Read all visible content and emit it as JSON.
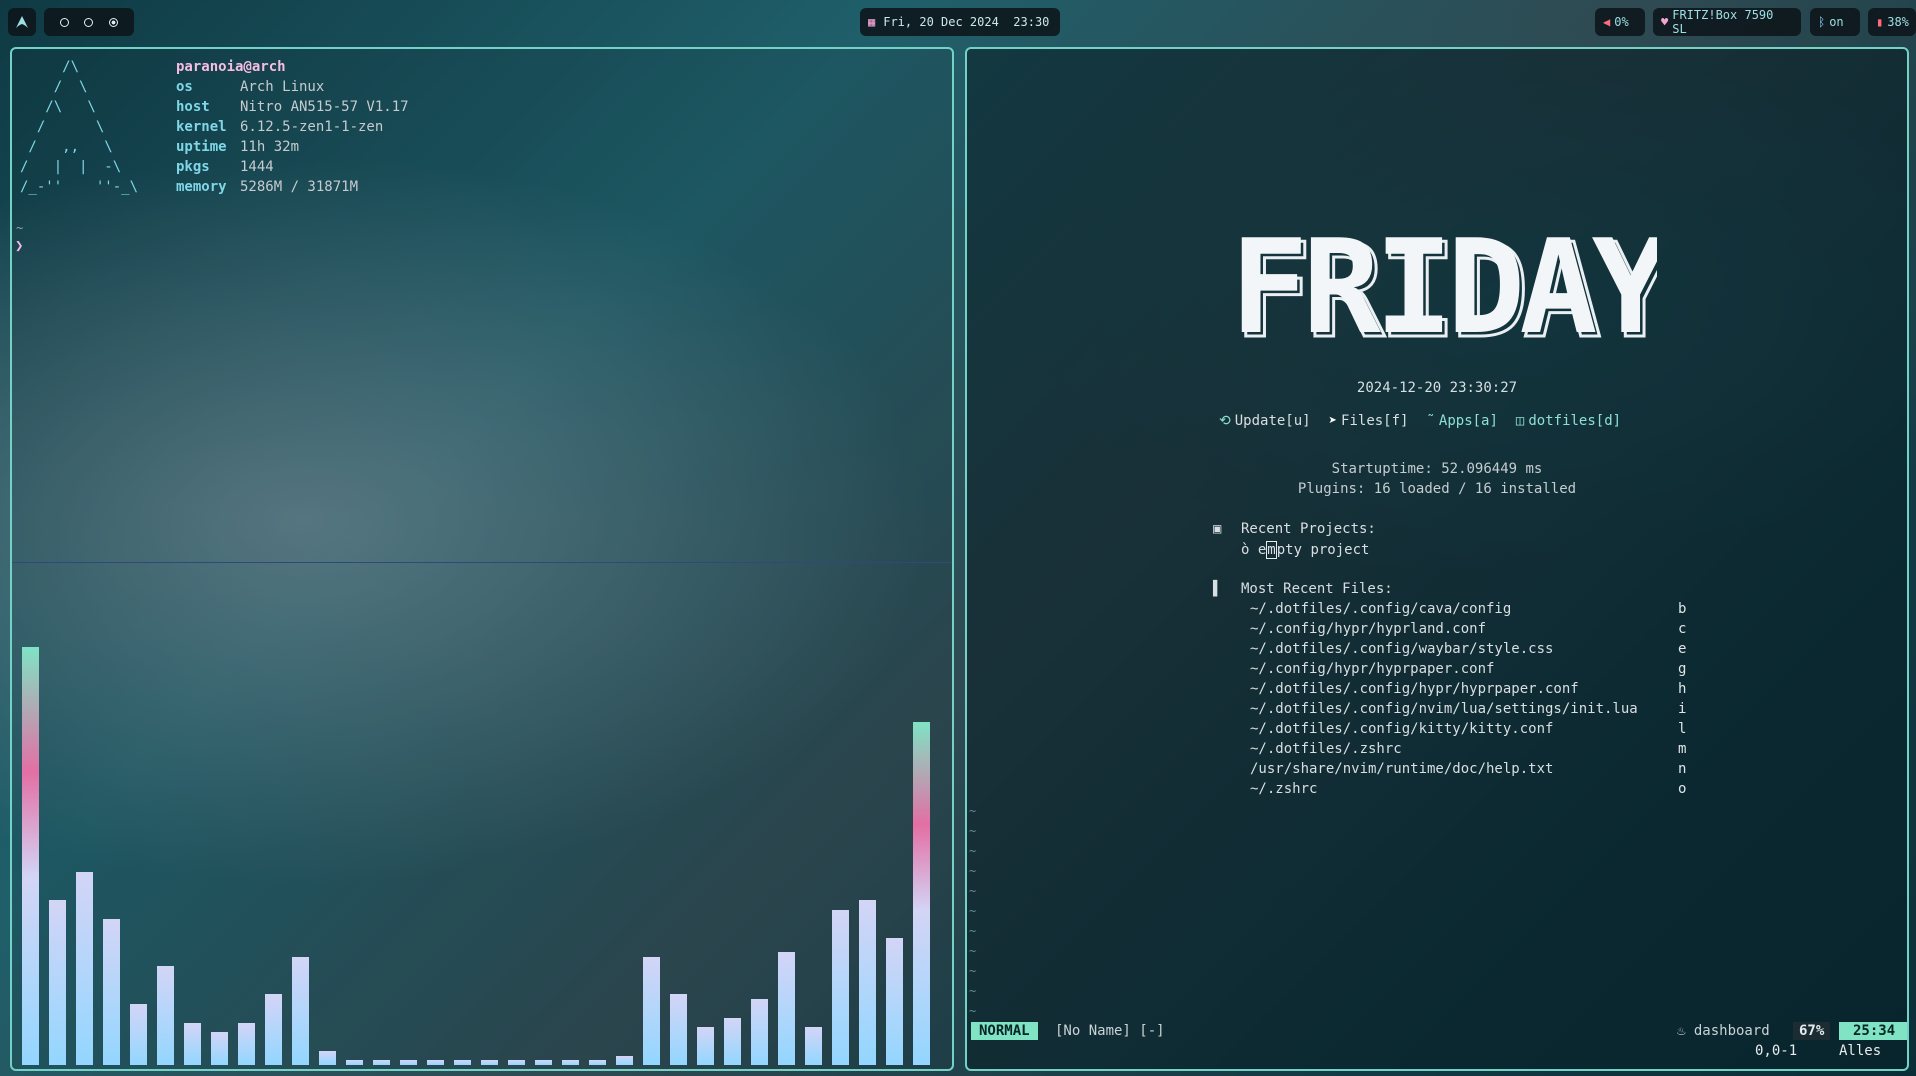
{
  "topbar": {
    "launcher_icon": "arch-logo-icon",
    "workspaces": [
      {
        "icon": "circle-icon",
        "active": false
      },
      {
        "icon": "circle-icon",
        "active": false
      },
      {
        "icon": "circle-dot-icon",
        "active": true
      }
    ],
    "calendar_icon": "calendar-icon",
    "clock": "Fri, 20 Dec 2024  23:30",
    "volume": "0%",
    "wifi": "FRITZ!Box 7590 SL",
    "bluetooth": "on",
    "battery": "38%"
  },
  "fetch": {
    "ascii_logo": "     /\\\n    /  \\\n   /\\   \\\n  /      \\\n /   ,,   \\\n/   |  |  -\\\n/_-''    ''-_\\",
    "user": "paranoia@arch",
    "rows": [
      {
        "key": "os",
        "value": "Arch Linux"
      },
      {
        "key": "host",
        "value": "Nitro AN515-57 V1.17"
      },
      {
        "key": "kernel",
        "value": "6.12.5-zen1-1-zen"
      },
      {
        "key": "uptime",
        "value": "11h 32m"
      },
      {
        "key": "pkgs",
        "value": "1444"
      },
      {
        "key": "memory",
        "value": "5286M / 31871M"
      }
    ],
    "tilde": "~",
    "prompt": "❯"
  },
  "cava": {
    "levels": [
      0.89,
      0.35,
      0.41,
      0.31,
      0.13,
      0.21,
      0.09,
      0.07,
      0.09,
      0.15,
      0.23,
      0.03,
      0.01,
      0.01,
      0.01,
      0.01,
      0.01,
      0.01,
      0.01,
      0.01,
      0.01,
      0.01,
      0.02,
      0.23,
      0.15,
      0.08,
      0.1,
      0.14,
      0.24,
      0.08,
      0.33,
      0.35,
      0.27,
      0.73
    ],
    "colors": {
      "low": "#93d6ff",
      "high": "#d3d5f6",
      "peak": "#e36fa4",
      "accent": "#7fe3c4"
    }
  },
  "nvim": {
    "header_word": "FRIDAY",
    "datetime": "2024-12-20 23:30:27",
    "buttons": [
      {
        "icon": "refresh-icon",
        "label": "Update[u]"
      },
      {
        "icon": "send-icon",
        "label": "Files[f]"
      },
      {
        "icon": "tilde-icon",
        "label": "Apps[a]"
      },
      {
        "icon": "package-icon",
        "label": "dotfiles[d]"
      }
    ],
    "startuptime": "Startuptime: 52.096449 ms",
    "plugins": "Plugins: 16 loaded / 16 installed",
    "recent_projects_icon": "folder-icon",
    "recent_projects_title": "Recent Projects:",
    "empty_project_pre": "ò e",
    "empty_project_cursor": "m",
    "empty_project_post": "pty project",
    "recent_files_icon": "file-icon",
    "recent_files_title": "Most Recent Files:",
    "files": [
      {
        "path": "~/.dotfiles/.config/cava/config",
        "key": "b"
      },
      {
        "path": "~/.config/hypr/hyprland.conf",
        "key": "c"
      },
      {
        "path": "~/.dotfiles/.config/waybar/style.css",
        "key": "e"
      },
      {
        "path": "~/.config/hypr/hyprpaper.conf",
        "key": "g"
      },
      {
        "path": "~/.dotfiles/.config/hypr/hyprpaper.conf",
        "key": "h"
      },
      {
        "path": "~/.dotfiles/.config/nvim/lua/settings/init.lua",
        "key": "i"
      },
      {
        "path": "~/.dotfiles/.config/kitty/kitty.conf",
        "key": "l"
      },
      {
        "path": "~/.dotfiles/.zshrc",
        "key": "m"
      },
      {
        "path": "/usr/share/nvim/runtime/doc/help.txt",
        "key": "n"
      },
      {
        "path": "~/.zshrc",
        "key": "o"
      }
    ],
    "tildes": "~\n~\n~\n~\n~\n~\n~\n~\n~\n~\n~",
    "status": {
      "mode": "NORMAL",
      "buffer": "[No Name] [-]",
      "filetype_icon": "flame-icon",
      "filetype": "dashboard",
      "percent": "67%",
      "time": "25:34"
    },
    "cmdline": {
      "position": "0,0-1",
      "scroll": "Alles"
    }
  }
}
